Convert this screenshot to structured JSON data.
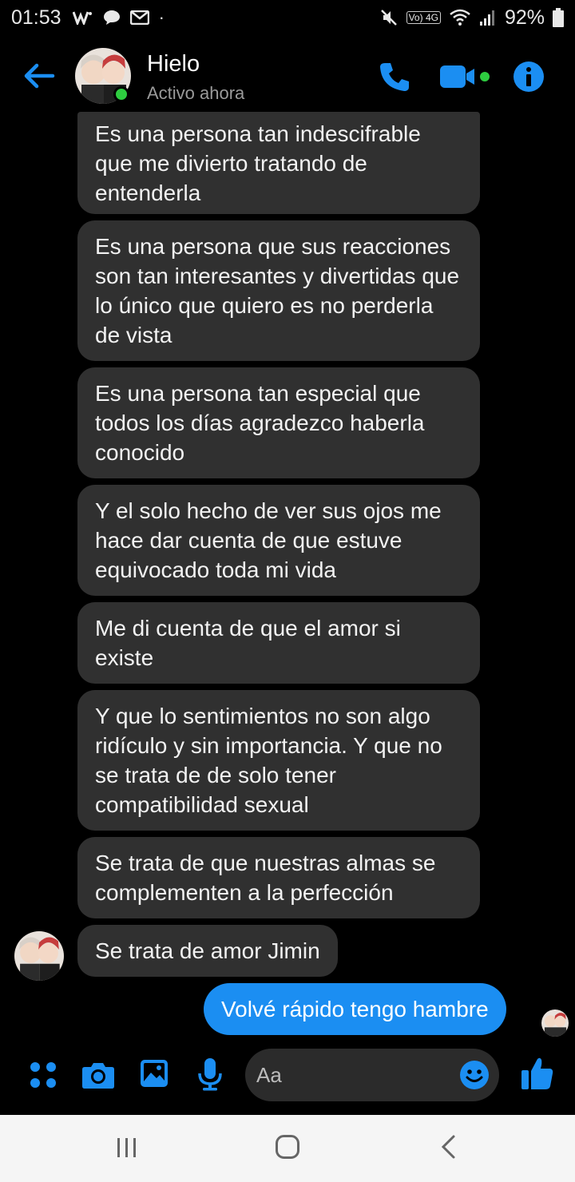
{
  "status_bar": {
    "time": "01:53",
    "network_label": "Vo) 4G",
    "battery": "92%"
  },
  "header": {
    "contact_name": "Hielo",
    "contact_status": "Activo ahora",
    "accent_color": "#1b8ef2",
    "icons": [
      "back-arrow-icon",
      "phone-icon",
      "video-icon",
      "info-icon"
    ]
  },
  "messages": {
    "received": [
      "Es una persona tan indescifrable que me divierto tratando de entenderla",
      "Es una persona que sus reacciones son tan interesantes y divertidas que lo único que quiero es no perderla de vista",
      "Es una persona tan especial que todos los días agradezco haberla conocido",
      "Y el solo hecho de ver sus ojos me hace dar cuenta de que estuve equivocado toda mi vida",
      "Me di cuenta de que el amor si existe",
      "Y que lo sentimientos no son algo ridículo y sin importancia. Y que no se trata de de solo tener compatibilidad sexual",
      "Se trata de que nuestras almas se complementen a la perfección",
      "Se trata de amor Jimin"
    ],
    "sent": [
      "Volvé rápido tengo hambre"
    ],
    "received_bubble_color": "#303030",
    "sent_bubble_color": "#1b8ef2"
  },
  "composer": {
    "placeholder": "Aa",
    "icons": [
      "apps-icon",
      "camera-icon",
      "gallery-icon",
      "microphone-icon",
      "emoji-icon",
      "thumbs-up-icon"
    ]
  },
  "nav_bar": {
    "icons": [
      "recent-apps-icon",
      "home-icon",
      "back-icon"
    ]
  }
}
